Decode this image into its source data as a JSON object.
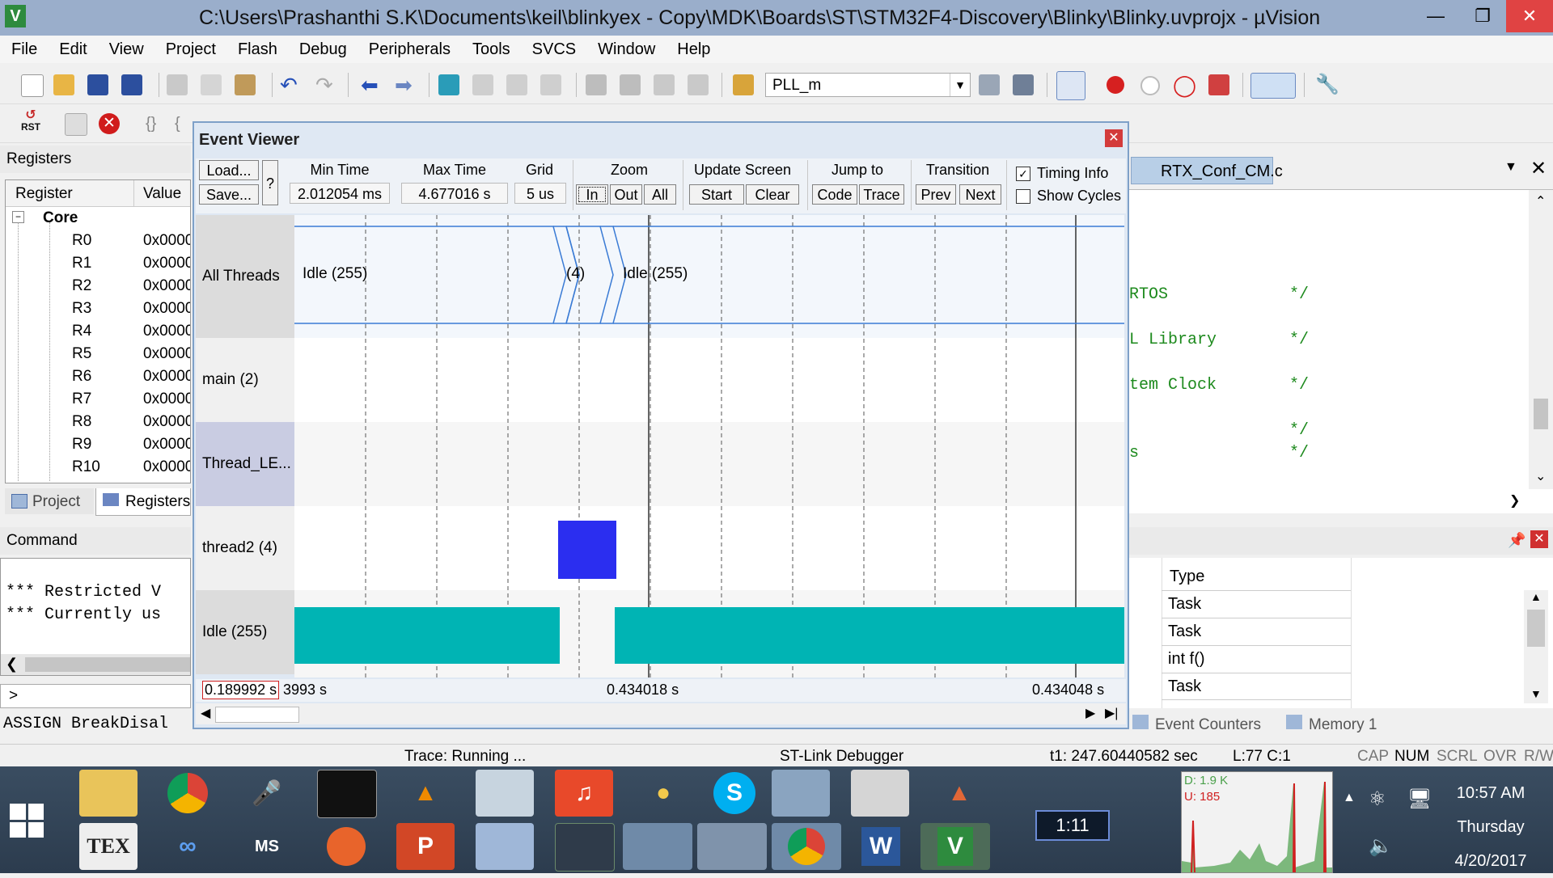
{
  "window": {
    "title": "C:\\Users\\Prashanthi S.K\\Documents\\keil\\blinkyex - Copy\\MDK\\Boards\\ST\\STM32F4-Discovery\\Blinky\\Blinky.uvprojx - µVision"
  },
  "menu": [
    "File",
    "Edit",
    "View",
    "Project",
    "Flash",
    "Debug",
    "Peripherals",
    "Tools",
    "SVCS",
    "Window",
    "Help"
  ],
  "toolbar": {
    "combo_value": "PLL_m",
    "rst_label": "RST"
  },
  "registers": {
    "title": "Registers",
    "col_register": "Register",
    "col_value": "Value",
    "group": "Core",
    "items": [
      {
        "name": "R0",
        "value": "0x0000"
      },
      {
        "name": "R1",
        "value": "0x0000"
      },
      {
        "name": "R2",
        "value": "0x0000"
      },
      {
        "name": "R3",
        "value": "0x0000"
      },
      {
        "name": "R4",
        "value": "0x0000"
      },
      {
        "name": "R5",
        "value": "0x0000"
      },
      {
        "name": "R6",
        "value": "0x0000"
      },
      {
        "name": "R7",
        "value": "0x0000"
      },
      {
        "name": "R8",
        "value": "0x0000"
      },
      {
        "name": "R9",
        "value": "0x0000"
      },
      {
        "name": "R10",
        "value": "0x0000"
      }
    ],
    "tab_project": "Project",
    "tab_registers": "Registers"
  },
  "command": {
    "title": "Command",
    "line1": "*** Restricted V",
    "line2": "*** Currently us",
    "prompt": ">",
    "assign": "ASSIGN BreakDisal"
  },
  "event_viewer": {
    "title": "Event Viewer",
    "load": "Load...",
    "save": "Save...",
    "help": "?",
    "min_time_label": "Min Time",
    "min_time": "2.012054 ms",
    "max_time_label": "Max Time",
    "max_time": "4.677016 s",
    "grid_label": "Grid",
    "grid": "5 us",
    "zoom_label": "Zoom",
    "zoom_in": "In",
    "zoom_out": "Out",
    "zoom_all": "All",
    "update_label": "Update Screen",
    "update_start": "Start",
    "update_clear": "Clear",
    "jump_label": "Jump to",
    "jump_code": "Code",
    "jump_trace": "Trace",
    "transition_label": "Transition",
    "prev": "Prev",
    "next": "Next",
    "timing_info": "Timing Info",
    "show_cycles": "Show Cycles",
    "lanes": [
      "All Threads",
      "main (2)",
      "Thread_LE...",
      "thread2 (4)",
      "Idle (255)"
    ],
    "all_threads_segments": [
      "Idle (255)",
      "(4)",
      "Idle (255)"
    ],
    "time_left": "0.189992 s",
    "time_left_partial": "3993 s",
    "time_mid": "0.434018 s",
    "time_right": "0.434048 s"
  },
  "editor": {
    "tab": "RTX_Conf_CM.c",
    "lines": [
      {
        "text": "RTOS",
        "comment": "*/"
      },
      {
        "text": "L Library",
        "comment": "*/"
      },
      {
        "text": "tem Clock",
        "comment": "*/"
      },
      {
        "text": "",
        "comment": "*/"
      },
      {
        "text": "s",
        "comment": "*/"
      }
    ]
  },
  "watch": {
    "col_type": "Type",
    "rows": [
      "Task",
      "Task",
      "int f()",
      "Task"
    ],
    "tab_event_counters": "Event Counters",
    "tab_memory": "Memory 1"
  },
  "statusbar": {
    "trace": "Trace: Running ...",
    "debugger": "ST-Link Debugger",
    "t1": "t1: 247.60440582 sec",
    "pos": "L:77 C:1",
    "cap": "CAP",
    "num": "NUM",
    "scrl": "SCRL",
    "ovr": "OVR",
    "rw": "R/W"
  },
  "taskbar": {
    "clock_widget": "1:11",
    "net_d": "D: 1.9 K",
    "net_u": "U: 185",
    "time": "10:57 AM",
    "day": "Thursday",
    "date": "4/20/2017",
    "tex": "TEX",
    "ms": "MS"
  },
  "colors": {
    "thread2": "#2b2ef0",
    "idle": "#00b4b4",
    "accent": "#9aaecb"
  }
}
